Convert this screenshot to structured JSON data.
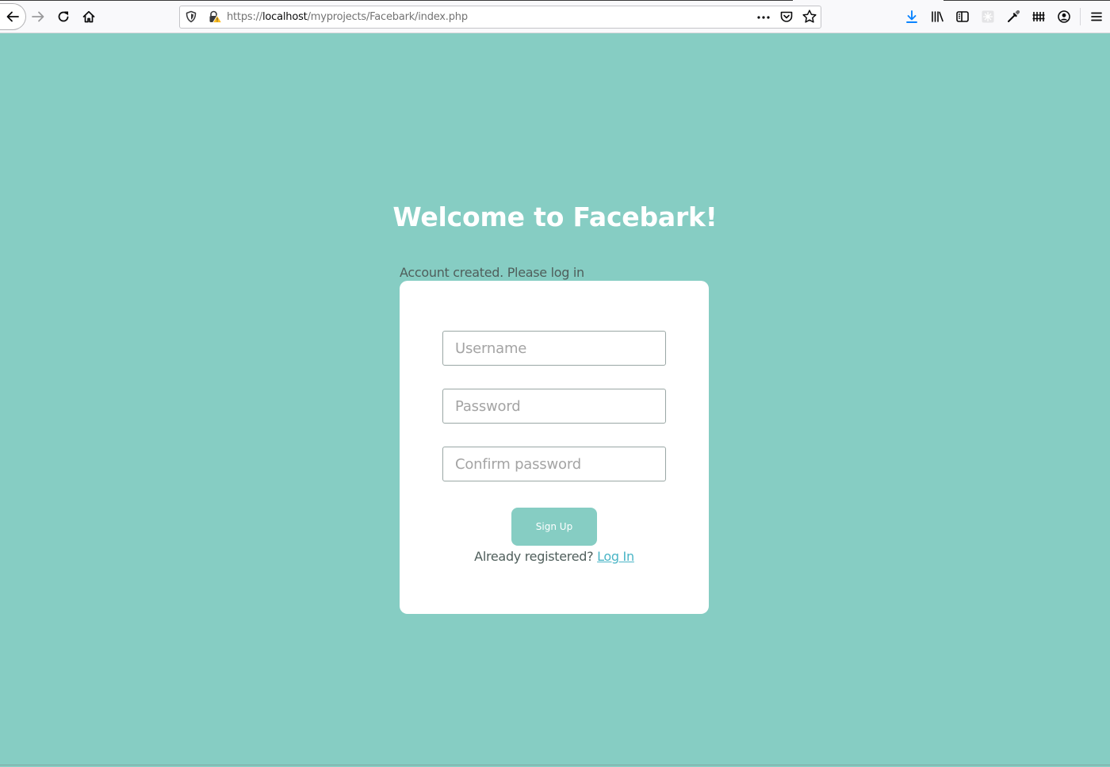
{
  "browser": {
    "url_prefix": "https://",
    "url_host": "localhost",
    "url_path": "/myprojects/Facebark/index.php"
  },
  "colors": {
    "page_background": "#86cdc3",
    "card_background": "#ffffff",
    "button_background": "#86cdc3",
    "link": "#4ab5c6"
  },
  "page": {
    "title": "Welcome to Facebark!",
    "status_message": "Account created. Please log in"
  },
  "form": {
    "username_placeholder": "Username",
    "password_placeholder": "Password",
    "confirm_placeholder": "Confirm password",
    "username_value": "",
    "password_value": "",
    "confirm_value": "",
    "submit_label": "Sign Up",
    "login_prompt": "Already registered?",
    "login_link": "Log In"
  },
  "icons": {
    "back": "back-arrow-icon",
    "forward": "forward-arrow-icon",
    "reload": "reload-icon",
    "home": "home-icon",
    "tracking": "shield-icon",
    "insecure": "insecure-lock-icon",
    "more": "more-actions-icon",
    "pocket": "pocket-icon",
    "bookmark": "bookmark-star-icon",
    "downloads": "download-icon",
    "library": "library-icon",
    "sidebar": "sidebar-icon",
    "extension": "extension-icon",
    "eyedropper": "eyedropper-icon",
    "fence": "fence-icon",
    "account": "account-icon",
    "menu": "hamburger-menu-icon"
  }
}
